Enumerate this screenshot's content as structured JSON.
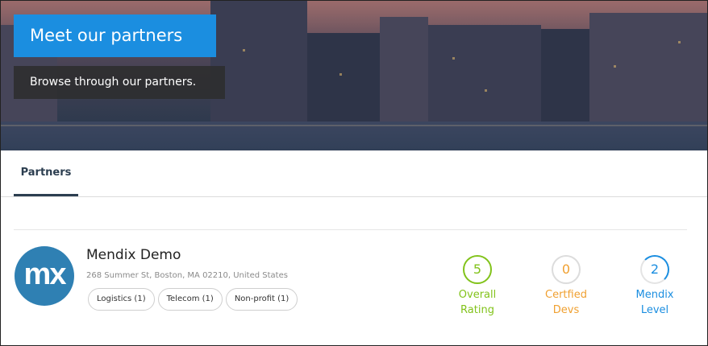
{
  "hero": {
    "title": "Meet our partners",
    "subtitle": "Browse through our partners."
  },
  "tabs": [
    {
      "label": "Partners",
      "active": true
    }
  ],
  "partner": {
    "logo_text": "mx",
    "name": "Mendix Demo",
    "address": "268 Summer St, Boston, MA 02210, United States",
    "tags": [
      "Logistics (1)",
      "Telecom (1)",
      "Non-profit (1)"
    ],
    "stats": [
      {
        "value": "5",
        "label_line1": "Overall",
        "label_line2": "Rating",
        "color": "#82c31b"
      },
      {
        "value": "0",
        "label_line1": "Certfied",
        "label_line2": "Devs",
        "color": "#f0a030"
      },
      {
        "value": "2",
        "label_line1": "Mendix",
        "label_line2": "Level",
        "color": "#1b8ee0"
      }
    ]
  },
  "colors": {
    "accent": "#1b8ee0",
    "tab_indicator": "#2c3e50"
  }
}
